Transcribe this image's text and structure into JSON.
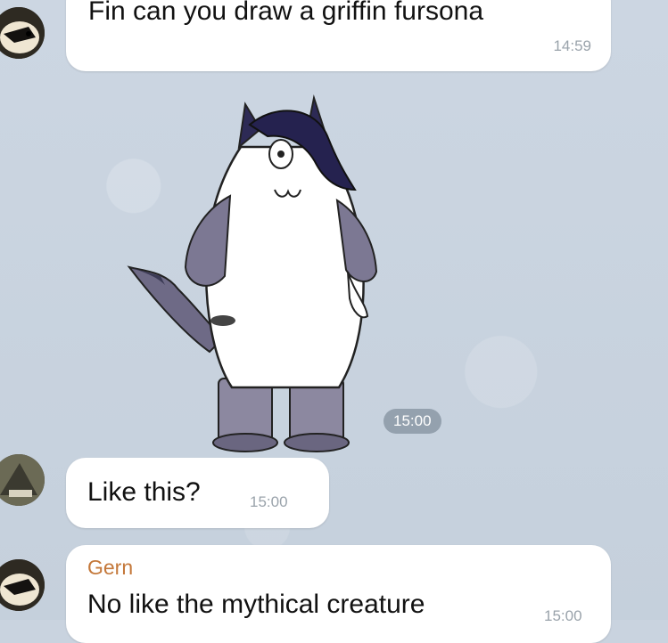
{
  "chat": {
    "messages": [
      {
        "text": "Fin can you draw a griffin fursona",
        "time": "14:59"
      },
      {
        "sticker": "griffin-fursona-sticker",
        "time": "15:00"
      },
      {
        "text": "Like this?",
        "time": "15:00"
      },
      {
        "sender": "Gern",
        "text": "No like the mythical creature",
        "time": "15:00"
      }
    ]
  },
  "colors": {
    "background": "#c9d3df",
    "bubble": "#ffffff",
    "sender": "#c4783a",
    "timestamp": "#9aa3ab"
  }
}
